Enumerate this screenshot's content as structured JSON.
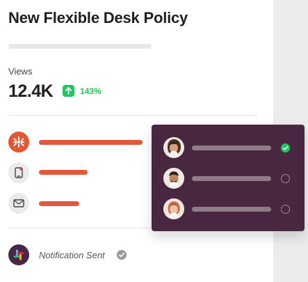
{
  "page": {
    "title": "New Flexible Desk Policy",
    "views_label": "Views",
    "views_value": "12.4K",
    "views_change": "143%"
  },
  "channels": [
    {
      "icon": "zapier-icon",
      "progress": 1.0
    },
    {
      "icon": "mobile-icon",
      "progress": 0.47
    },
    {
      "icon": "mail-icon",
      "progress": 0.39
    }
  ],
  "notification": {
    "icon": "slack-icon",
    "text": "Notification Sent",
    "status": "sent"
  },
  "recipients": [
    {
      "avatar": "avatar-woman",
      "status": "checked"
    },
    {
      "avatar": "avatar-man",
      "status": "unchecked"
    },
    {
      "avatar": "avatar-woman-2",
      "status": "unchecked"
    }
  ],
  "colors": {
    "accent": "#e3573e",
    "success": "#22c55e",
    "popup": "#4a2741",
    "slack": "#4a2747"
  }
}
